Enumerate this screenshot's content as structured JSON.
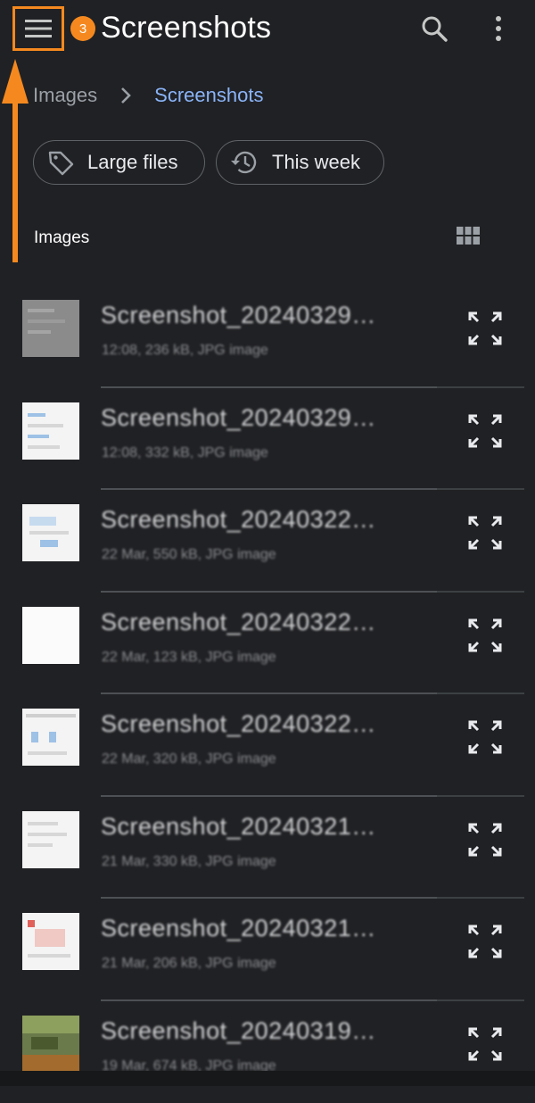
{
  "header": {
    "title": "Screenshots",
    "step_badge": "3",
    "menu_icon": "hamburger-menu-icon",
    "search_icon": "search-icon",
    "more_icon": "more-vertical-icon"
  },
  "annotation": {
    "color": "#f5891f"
  },
  "breadcrumb": {
    "root": "Images",
    "current": "Screenshots"
  },
  "chips": [
    {
      "label": "Large files",
      "icon": "tag-icon"
    },
    {
      "label": "This week",
      "icon": "history-icon"
    }
  ],
  "section": {
    "label": "Images",
    "view_icon": "grid-view-icon"
  },
  "files": [
    {
      "name": "Screenshot_20240329…",
      "meta": "12:08, 236 kB, JPG image"
    },
    {
      "name": "Screenshot_20240329…",
      "meta": "12:08, 332 kB, JPG image"
    },
    {
      "name": "Screenshot_20240322…",
      "meta": "22 Mar, 550 kB, JPG image"
    },
    {
      "name": "Screenshot_20240322…",
      "meta": "22 Mar, 123 kB, JPG image"
    },
    {
      "name": "Screenshot_20240322…",
      "meta": "22 Mar, 320 kB, JPG image"
    },
    {
      "name": "Screenshot_20240321…",
      "meta": "21 Mar, 330 kB, JPG image"
    },
    {
      "name": "Screenshot_20240321…",
      "meta": "21 Mar, 206 kB, JPG image"
    },
    {
      "name": "Screenshot_20240319…",
      "meta": "19 Mar, 674 kB, JPG image"
    }
  ],
  "colors": {
    "background": "#202124",
    "accent_link": "#8ab4f8",
    "annotation_orange": "#f5891f"
  }
}
